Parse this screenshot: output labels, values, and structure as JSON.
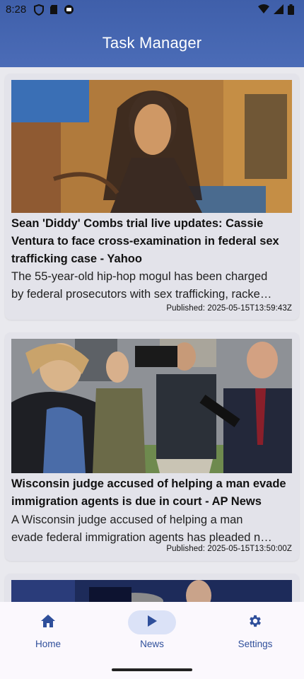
{
  "status": {
    "time": "8:28"
  },
  "app": {
    "title": "Task Manager"
  },
  "articles": [
    {
      "headline_l1": "Sean 'Diddy' Combs trial live updates: Cassie",
      "headline_l2": "Ventura to face cross-examination in federal sex",
      "headline_l3": "trafficking case - Yahoo",
      "desc_l1": "The 55-year-old hip-hop mogul has been charged",
      "desc_l2": "by federal prosecutors with sex trafficking, racke…",
      "published": "Published: 2025-05-15T13:59:43Z"
    },
    {
      "headline_l1": "Wisconsin judge accused of helping a man evade",
      "headline_l2": "immigration agents is due in court - AP News",
      "desc_l1": "A Wisconsin judge accused of helping a man",
      "desc_l2": "evade federal immigration agents has pleaded n…",
      "published": "Published: 2025-05-15T13:50:00Z"
    }
  ],
  "nav": {
    "home": "Home",
    "news": "News",
    "settings": "Settings",
    "active": "news"
  },
  "colors": {
    "appbar": "#4b6cb7",
    "nav_accent": "#2f4f9b",
    "active_pill": "#dbe2f7"
  }
}
